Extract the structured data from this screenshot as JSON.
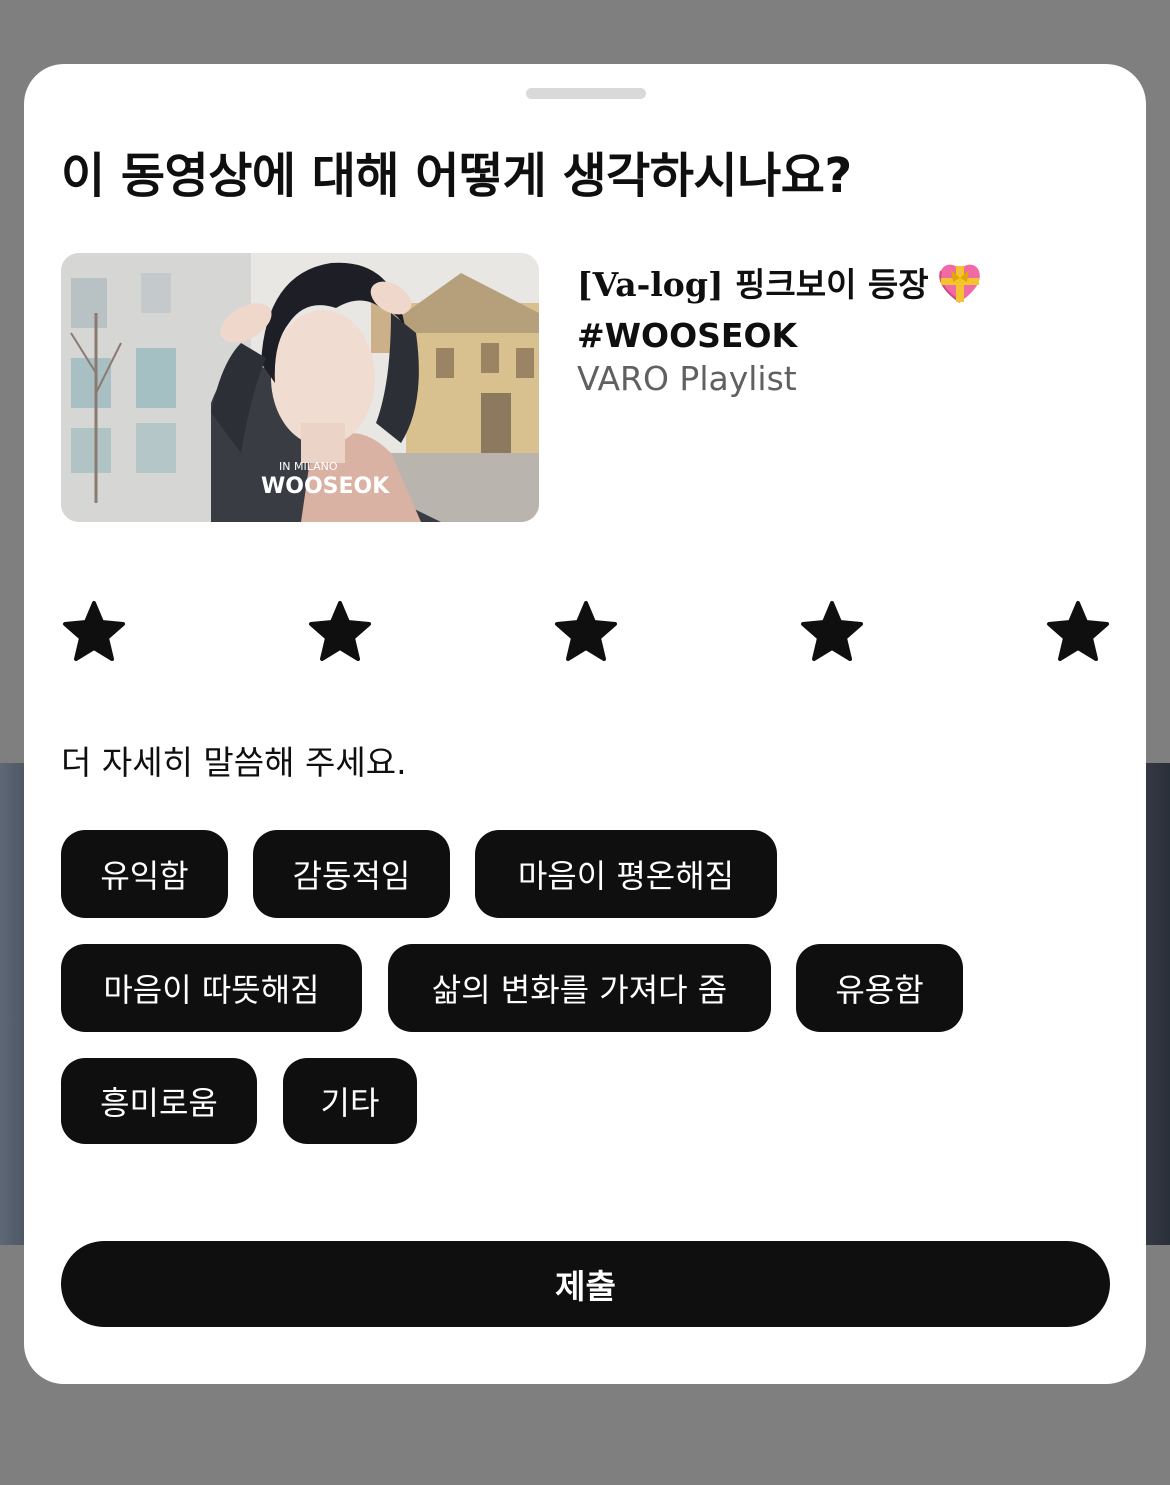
{
  "sheet": {
    "title": "이 동영상에 대해 어떻게 생각하시나요?"
  },
  "video": {
    "title": "[Va-log] 핑크보이 등장",
    "title_emoji": "heart-with-ribbon-emoji",
    "hashtag": "#WOOSEOK",
    "channel": "VARO Playlist",
    "thumbnail_overlay": {
      "line1": "IN MILANO",
      "line2": "WOOSEOK"
    }
  },
  "rating": {
    "max": 5,
    "stars": [
      "star-icon",
      "star-icon",
      "star-icon",
      "star-icon",
      "star-icon"
    ],
    "star_color": "#0f0f0f"
  },
  "details": {
    "prompt": "더 자세히 말씀해 주세요.",
    "options": [
      "유익함",
      "감동적임",
      "마음이 평온해짐",
      "마음이 따뜻해짐",
      "삶의 변화를 가져다 줌",
      "유용함",
      "흥미로움",
      "기타"
    ]
  },
  "submit": {
    "label": "제출"
  },
  "colors": {
    "scrim": "#7f7f7f",
    "sheet": "#ffffff",
    "chip_bg": "#0f0f0f",
    "chip_text": "#ffffff",
    "secondary_text": "#606060"
  }
}
